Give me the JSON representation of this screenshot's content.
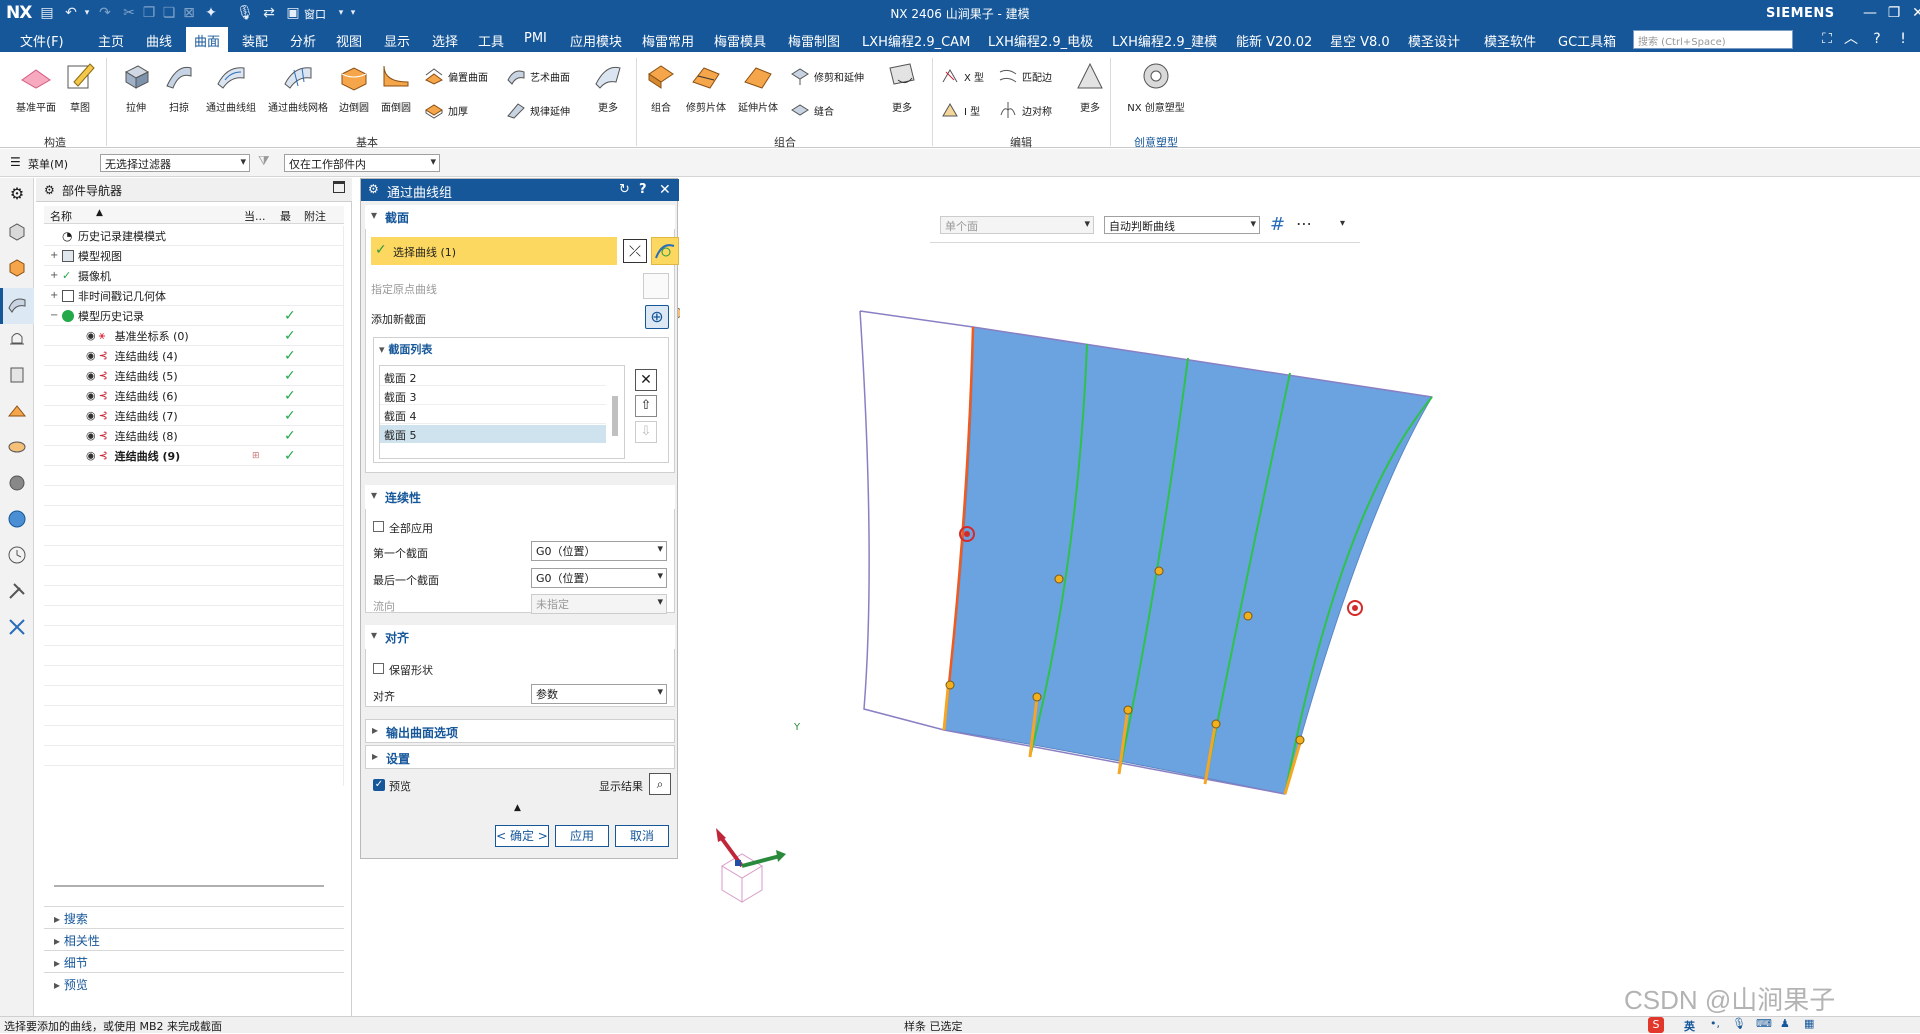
{
  "titlebar": {
    "logo": "NX",
    "window_menu": "窗口",
    "title": "NX 2406 山涧果子 - 建模",
    "brand": "SIEMENS"
  },
  "menubar": {
    "items": [
      "文件(F)",
      "主页",
      "曲线",
      "曲面",
      "装配",
      "分析",
      "视图",
      "显示",
      "选择",
      "工具",
      "PMI",
      "应用模块",
      "梅雷常用",
      "梅雷模具",
      "梅雷制图",
      "LXH编程2.9_CAM",
      "LXH编程2.9_电极",
      "LXH编程2.9_建模",
      "能新 V20.02",
      "星空 V8.0",
      "模圣设计",
      "模圣软件",
      "GC工具箱"
    ],
    "active_index": 3,
    "search_placeholder": "搜索 (Ctrl+Space)"
  },
  "ribbon": {
    "construct": {
      "items": [
        "基准平面",
        "草图"
      ],
      "group": "构造"
    },
    "basic": {
      "items": [
        "拉伸",
        "扫掠",
        "通过曲线组",
        "通过曲线网格",
        "边倒圆",
        "面倒圆"
      ],
      "small": [
        "偏置曲面",
        "加厚",
        "艺术曲面",
        "规律延伸"
      ],
      "more": "更多",
      "group": "基本"
    },
    "combine": {
      "items": [
        "组合",
        "修剪片体",
        "延伸片体"
      ],
      "small": [
        "修剪和延伸",
        "缝合"
      ],
      "more": "更多",
      "group": "组合"
    },
    "edit": {
      "small": [
        "X 型",
        "I 型",
        "匹配边",
        "边对称"
      ],
      "more": "更多",
      "group": "编辑"
    },
    "creative": {
      "items": [
        "NX 创意塑型"
      ],
      "group": "创意塑型"
    }
  },
  "toolbar2": {
    "menu_label": "菜单(M)",
    "filter": "无选择过滤器",
    "scope": "仅在工作部件内"
  },
  "navigator": {
    "title": "部件导航器",
    "columns": [
      "名称",
      "当...",
      "最",
      "附注"
    ],
    "rows": [
      {
        "label": "历史记录建模模式",
        "indent": 0,
        "check": false
      },
      {
        "label": "模型视图",
        "indent": 0,
        "check": false
      },
      {
        "label": "摄像机",
        "indent": 0,
        "check": false
      },
      {
        "label": "非时间戳记几何体",
        "indent": 0,
        "check": false
      },
      {
        "label": "模型历史记录",
        "indent": 0,
        "check": true
      },
      {
        "label": "基准坐标系 (0)",
        "indent": 1,
        "check": true
      },
      {
        "label": "连结曲线 (4)",
        "indent": 1,
        "check": true
      },
      {
        "label": "连结曲线 (5)",
        "indent": 1,
        "check": true
      },
      {
        "label": "连结曲线 (6)",
        "indent": 1,
        "check": true
      },
      {
        "label": "连结曲线 (7)",
        "indent": 1,
        "check": true
      },
      {
        "label": "连结曲线 (8)",
        "indent": 1,
        "check": true
      },
      {
        "label": "连结曲线 (9)",
        "indent": 1,
        "check": true,
        "bold": true
      }
    ],
    "sections": [
      "搜索",
      "相关性",
      "细节",
      "预览"
    ]
  },
  "dialog": {
    "title": "通过曲线组",
    "section_label": "截面",
    "select_curve": "选择曲线 (1)",
    "specify_origin": "指定原点曲线",
    "add_section": "添加新截面",
    "section_list_label": "截面列表",
    "section_list": [
      "截面 2",
      "截面 3",
      "截面 4",
      "截面 5"
    ],
    "continuity_label": "连续性",
    "apply_all": "全部应用",
    "first_section": "第一个截面",
    "first_value": "G0（位置）",
    "last_section": "最后一个截面",
    "last_value": "G0（位置）",
    "flow": "流向",
    "flow_value": "未指定",
    "align_label": "对齐",
    "keep_shape": "保留形状",
    "align": "对齐",
    "align_value": "参数",
    "output_options": "输出曲面选项",
    "settings": "设置",
    "preview": "预览",
    "show_result": "显示结果",
    "ok": "< 确定 >",
    "apply": "应用",
    "cancel": "取消"
  },
  "viewport": {
    "face_filter": "单个面",
    "curve_rule": "自动判断曲线",
    "watermark": "CSDN @山涧果子",
    "axis_y": "Y"
  },
  "statusbar": {
    "left": "选择要添加的曲线，或使用 MB2 来完成截面",
    "center": "样条 已选定",
    "ime": "英"
  },
  "colors": {
    "titlebar": "#16579a",
    "surface": "#6ba2e0",
    "curve_green": "#2ec24a",
    "highlight_yellow": "#fcd860"
  }
}
